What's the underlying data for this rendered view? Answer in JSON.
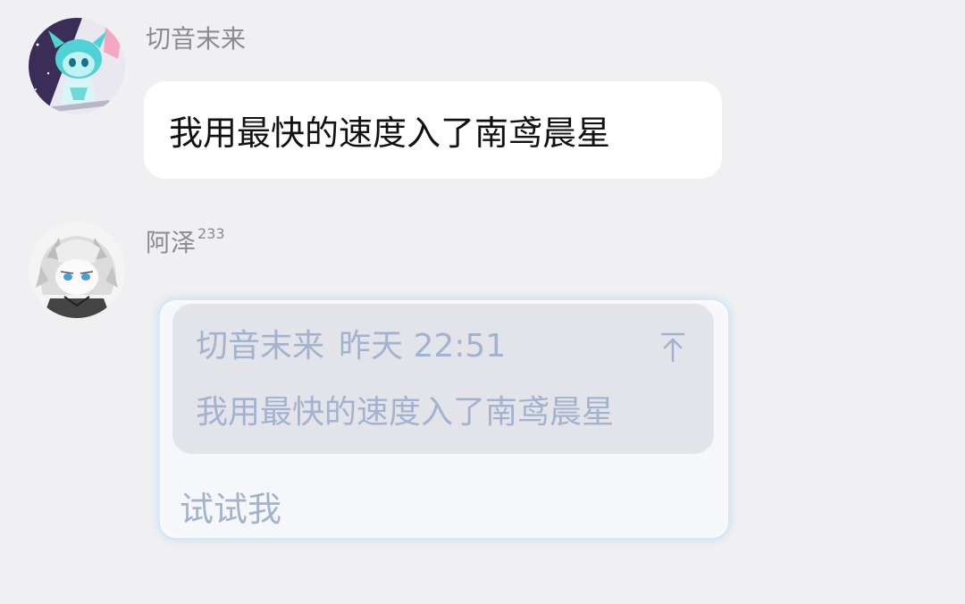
{
  "messages": [
    {
      "sender": "切音末来",
      "avatar_icon": "anime-avatar-cyan-icon",
      "text": "我用最快的速度入了南鸢晨星"
    },
    {
      "sender": "阿泽",
      "sender_badge": "233",
      "avatar_icon": "anime-avatar-monochrome-icon",
      "quote": {
        "author": "切音末来",
        "time": "昨天 22:51",
        "text": "我用最快的速度入了南鸢晨星",
        "jump_icon": "arrow-up-to-line-icon"
      },
      "reply_text": "试试我"
    }
  ],
  "colors": {
    "background": "#f0f0f3",
    "bubble": "#ffffff",
    "quote_text": "#a3b2cf",
    "sender_name": "#8b8b90"
  }
}
